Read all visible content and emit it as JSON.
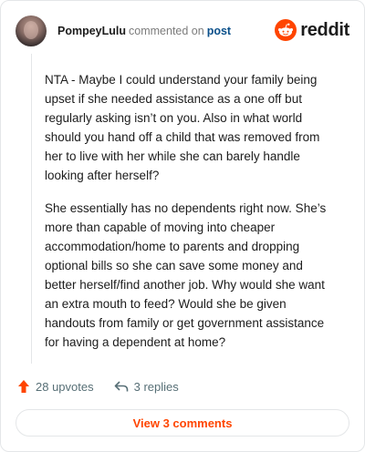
{
  "comment": {
    "username": "PompeyLulu",
    "commented_text": "commented on",
    "post_link": "post",
    "paragraphs": [
      "NTA - Maybe I could understand your family being upset if she needed assistance as a one off but regularly asking isn’t on you. Also in what world should you hand off a child that was removed from her to live with her while she can barely handle looking after herself?",
      "She essentially has no dependents right now. She’s more than capable of moving into cheaper accommodation/home to parents and dropping optional bills so she can save some money and better herself/find another job. Why would she want an extra mouth to feed? Would she be given handouts from family or get government assistance for having a dependent at home?"
    ]
  },
  "brand": {
    "logo_text": "reddit",
    "logo_icon": "reddit-snoo-icon",
    "accent_color": "#ff4500"
  },
  "actions": {
    "upvotes": "28 upvotes",
    "upvote_icon": "upvote-arrow-icon",
    "replies": "3 replies",
    "reply_icon": "reply-arrow-icon"
  },
  "footer": {
    "view_comments_label": "View 3 comments"
  }
}
